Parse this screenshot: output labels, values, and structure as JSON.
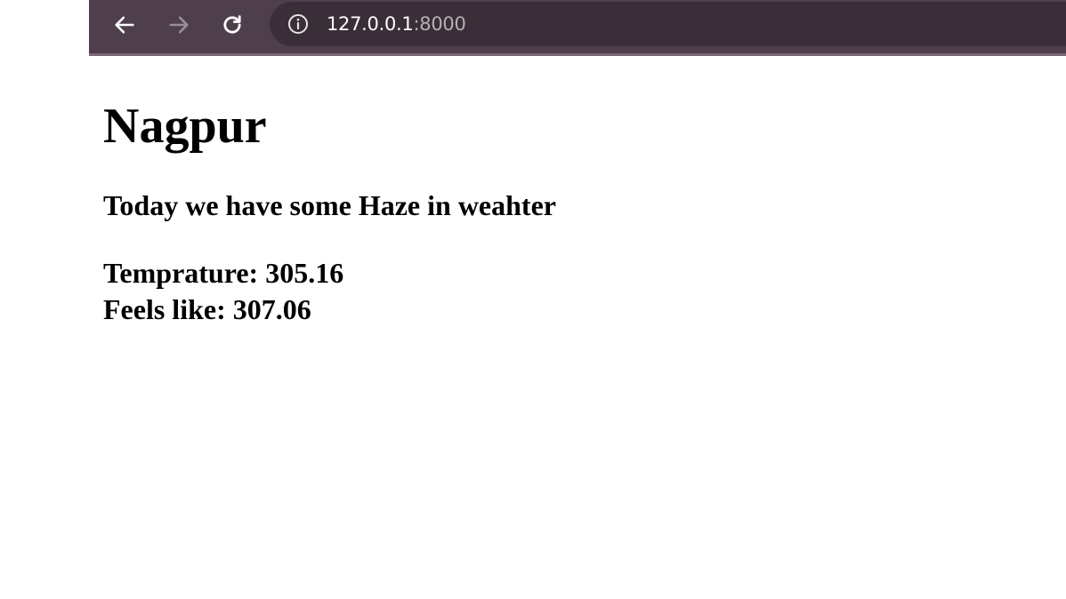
{
  "browser": {
    "url_host": "127.0.0.1",
    "url_port": ":8000",
    "icons": {
      "back": "arrow-left-icon",
      "forward": "arrow-right-icon",
      "reload": "reload-icon",
      "site_info": "info-icon"
    },
    "colors": {
      "toolbar": "#4f3f4c",
      "omnibox": "#3a2e38"
    }
  },
  "page": {
    "city": "Nagpur",
    "condition_text": "Today we have some Haze in weahter",
    "temperature_label": "Temprature: ",
    "temperature_value": "305.16",
    "feels_like_label": "Feels like: ",
    "feels_like_value": "307.06"
  }
}
